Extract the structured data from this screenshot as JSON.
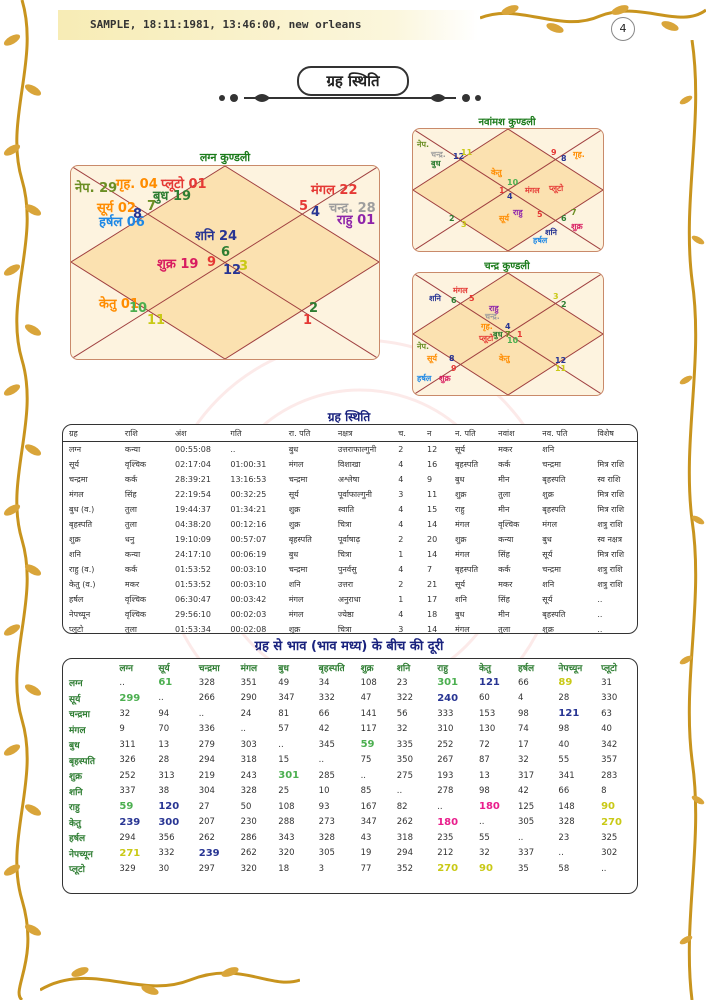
{
  "header": {
    "text": "SAMPLE, 18:11:1981, 13:46:00, new orleans",
    "page_number": "4"
  },
  "main_title": "ग्रह स्थिति",
  "lagna_kundli": {
    "title": "लग्न कुण्डली",
    "labels": [
      {
        "text": "नेप. 29",
        "color": "#6b8e23"
      },
      {
        "text": "गृह. 04",
        "color": "#ff8c00"
      },
      {
        "text": "प्लूटो 01",
        "color": "#e53935"
      },
      {
        "text": "बुध 19",
        "color": "#2e7d32"
      },
      {
        "text": "सूर्य 02",
        "color": "#ff8c00"
      },
      {
        "text": "हर्षल 06",
        "color": "#1e88e5"
      },
      {
        "text": "8",
        "color": "#283593"
      },
      {
        "text": "7",
        "color": "#6b8e23"
      },
      {
        "text": "मंगल 22",
        "color": "#e53935"
      },
      {
        "text": "5",
        "color": "#e53935"
      },
      {
        "text": "4",
        "color": "#283593"
      },
      {
        "text": "चन्द्र. 28",
        "color": "#9e9e9e"
      },
      {
        "text": "राहु 01",
        "color": "#8e24aa"
      },
      {
        "text": "शनि 24",
        "color": "#283593"
      },
      {
        "text": "6",
        "color": "#2e7d32"
      },
      {
        "text": "शुक्र 19",
        "color": "#d81b60"
      },
      {
        "text": "9",
        "color": "#e53935"
      },
      {
        "text": "12",
        "color": "#283593"
      },
      {
        "text": "3",
        "color": "#c9c916"
      },
      {
        "text": "केतु 01",
        "color": "#ff8c00"
      },
      {
        "text": "10",
        "color": "#4caf50"
      },
      {
        "text": "11",
        "color": "#c9c916"
      },
      {
        "text": "2",
        "color": "#2e7d32"
      },
      {
        "text": "1",
        "color": "#e53935"
      }
    ]
  },
  "navamsha_kundli": {
    "title": "नवांमश कुण्डली",
    "labels": [
      {
        "text": "नेप.",
        "color": "#6b8e23"
      },
      {
        "text": "चन्द्र.",
        "color": "#9e9e9e"
      },
      {
        "text": "बुध",
        "color": "#2e7d32"
      },
      {
        "text": "12",
        "color": "#283593"
      },
      {
        "text": "11",
        "color": "#c9c916"
      },
      {
        "text": "9",
        "color": "#e53935"
      },
      {
        "text": "8",
        "color": "#283593"
      },
      {
        "text": "गृह.",
        "color": "#ff8c00"
      },
      {
        "text": "केतु",
        "color": "#ff8c00"
      },
      {
        "text": "10",
        "color": "#4caf50"
      },
      {
        "text": "1",
        "color": "#e53935"
      },
      {
        "text": "4",
        "color": "#283593"
      },
      {
        "text": "मंगल",
        "color": "#e53935"
      },
      {
        "text": "प्लूटो",
        "color": "#e53935"
      },
      {
        "text": "2",
        "color": "#2e7d32"
      },
      {
        "text": "3",
        "color": "#c9c916"
      },
      {
        "text": "राहु",
        "color": "#8e24aa"
      },
      {
        "text": "सूर्य",
        "color": "#ff8c00"
      },
      {
        "text": "5",
        "color": "#e53935"
      },
      {
        "text": "6",
        "color": "#2e7d32"
      },
      {
        "text": "7",
        "color": "#6b8e23"
      },
      {
        "text": "शुक्र",
        "color": "#d81b60"
      },
      {
        "text": "शनि",
        "color": "#283593"
      },
      {
        "text": "हर्षल",
        "color": "#1e88e5"
      }
    ]
  },
  "chandra_kundli": {
    "title": "चन्द्र कुण्डली",
    "labels": [
      {
        "text": "मंगल",
        "color": "#e53935"
      },
      {
        "text": "शनि",
        "color": "#283593"
      },
      {
        "text": "6",
        "color": "#2e7d32"
      },
      {
        "text": "5",
        "color": "#e53935"
      },
      {
        "text": "3",
        "color": "#c9c916"
      },
      {
        "text": "2",
        "color": "#2e7d32"
      },
      {
        "text": "राहु",
        "color": "#8e24aa"
      },
      {
        "text": "चन्द्र.",
        "color": "#9e9e9e"
      },
      {
        "text": "4",
        "color": "#283593"
      },
      {
        "text": "गृह.",
        "color": "#ff8c00"
      },
      {
        "text": "बुध",
        "color": "#2e7d32"
      },
      {
        "text": "7",
        "color": "#6b8e23"
      },
      {
        "text": "प्लूटो",
        "color": "#e53935"
      },
      {
        "text": "1",
        "color": "#e53935"
      },
      {
        "text": "10",
        "color": "#4caf50"
      },
      {
        "text": "नेप.",
        "color": "#6b8e23"
      },
      {
        "text": "सूर्य",
        "color": "#ff8c00"
      },
      {
        "text": "8",
        "color": "#283593"
      },
      {
        "text": "9",
        "color": "#e53935"
      },
      {
        "text": "हर्षल",
        "color": "#1e88e5"
      },
      {
        "text": "शुक्र",
        "color": "#d81b60"
      },
      {
        "text": "केतु",
        "color": "#ff8c00"
      },
      {
        "text": "12",
        "color": "#283593"
      },
      {
        "text": "11",
        "color": "#c9c916"
      }
    ]
  },
  "graha_sthiti": {
    "title": "ग्रह स्थिति",
    "headers": [
      "ग्रह",
      "राशि",
      "अंश",
      "गति",
      "रा. पति",
      "नक्षत्र",
      "च.",
      "न",
      "न. पति",
      "नवांश",
      "नव. पति",
      "विशेष"
    ],
    "rows": [
      [
        "लग्न",
        "कन्या",
        "00:55:08",
        "..",
        "बुध",
        "उत्तराफाल्गुनी",
        "2",
        "12",
        "सूर्य",
        "मकर",
        "शनि",
        ""
      ],
      [
        "सूर्य",
        "वृश्चिक",
        "02:17:04",
        "01:00:31",
        "मंगल",
        "विशाखा",
        "4",
        "16",
        "बृहस्पति",
        "कर्क",
        "चन्द्रमा",
        "मित्र राशि"
      ],
      [
        "चन्द्रमा",
        "कर्क",
        "28:39:21",
        "13:16:53",
        "चन्द्रमा",
        "अश्लेषा",
        "4",
        "9",
        "बुध",
        "मीन",
        "बृहस्पति",
        "स्व राशि"
      ],
      [
        "मंगल",
        "सिंह",
        "22:19:54",
        "00:32:25",
        "सूर्य",
        "पूर्वाफाल्गुनी",
        "3",
        "11",
        "शुक्र",
        "तुला",
        "शुक्र",
        "मित्र राशि"
      ],
      [
        "बुध (व.)",
        "तुला",
        "19:44:37",
        "01:34:21",
        "शुक्र",
        "स्वाति",
        "4",
        "15",
        "राहु",
        "मीन",
        "बृहस्पति",
        "मित्र राशि"
      ],
      [
        "बृहस्पति",
        "तुला",
        "04:38:20",
        "00:12:16",
        "शुक्र",
        "चित्रा",
        "4",
        "14",
        "मंगल",
        "वृश्चिक",
        "मंगल",
        "शत्रु राशि"
      ],
      [
        "शुक्र",
        "धनु",
        "19:10:09",
        "00:57:07",
        "बृहस्पति",
        "पूर्वाषाढ़",
        "2",
        "20",
        "शुक्र",
        "कन्या",
        "बुध",
        "स्व नक्षत्र"
      ],
      [
        "शनि",
        "कन्या",
        "24:17:10",
        "00:06:19",
        "बुध",
        "चित्रा",
        "1",
        "14",
        "मंगल",
        "सिंह",
        "सूर्य",
        "मित्र राशि"
      ],
      [
        "राहु (व.)",
        "कर्क",
        "01:53:52",
        "00:03:10",
        "चन्द्रमा",
        "पुनर्वसु",
        "4",
        "7",
        "बृहस्पति",
        "कर्क",
        "चन्द्रमा",
        "शत्रु राशि"
      ],
      [
        "केतु (व.)",
        "मकर",
        "01:53:52",
        "00:03:10",
        "शनि",
        "उत्तरा",
        "2",
        "21",
        "सूर्य",
        "मकर",
        "शनि",
        "शत्रु राशि"
      ],
      [
        "हर्षल",
        "वृश्चिक",
        "06:30:47",
        "00:03:42",
        "मंगल",
        "अनुराधा",
        "1",
        "17",
        "शनि",
        "सिंह",
        "सूर्य",
        ".."
      ],
      [
        "नेपच्यून",
        "वृश्चिक",
        "29:56:10",
        "00:02:03",
        "मंगल",
        "ज्येष्ठा",
        "4",
        "18",
        "बुध",
        "मीन",
        "बृहस्पति",
        ".."
      ],
      [
        "प्लूटो",
        "तुला",
        "01:53:34",
        "00:02:08",
        "शुक्र",
        "चित्रा",
        "3",
        "14",
        "मंगल",
        "तुला",
        "शुक्र",
        ".."
      ]
    ]
  },
  "bhava_distance": {
    "title": "ग्रह से भाव (भाव मध्य) के बीच की दूरी",
    "headers": [
      "",
      "लग्न",
      "सूर्य",
      "चन्द्रमा",
      "मंगल",
      "बुध",
      "बृहस्पति",
      "शुक्र",
      "शनि",
      "राहु",
      "केतु",
      "हर्षल",
      "नेपच्यून",
      "प्लूटो"
    ],
    "rows": [
      [
        "लग्न",
        "..",
        "61",
        "328",
        "351",
        "49",
        "34",
        "108",
        "23",
        "301",
        "121",
        "66",
        "89",
        "31"
      ],
      [
        "सूर्य",
        "299",
        "..",
        "266",
        "290",
        "347",
        "332",
        "47",
        "322",
        "240",
        "60",
        "4",
        "28",
        "330"
      ],
      [
        "चन्द्रमा",
        "32",
        "94",
        "..",
        "24",
        "81",
        "66",
        "141",
        "56",
        "333",
        "153",
        "98",
        "121",
        "63"
      ],
      [
        "मंगल",
        "9",
        "70",
        "336",
        "..",
        "57",
        "42",
        "117",
        "32",
        "310",
        "130",
        "74",
        "98",
        "40"
      ],
      [
        "बुध",
        "311",
        "13",
        "279",
        "303",
        "..",
        "345",
        "59",
        "335",
        "252",
        "72",
        "17",
        "40",
        "342"
      ],
      [
        "बृहस्पति",
        "326",
        "28",
        "294",
        "318",
        "15",
        "..",
        "75",
        "350",
        "267",
        "87",
        "32",
        "55",
        "357"
      ],
      [
        "शुक्र",
        "252",
        "313",
        "219",
        "243",
        "301",
        "285",
        "..",
        "275",
        "193",
        "13",
        "317",
        "341",
        "283"
      ],
      [
        "शनि",
        "337",
        "38",
        "304",
        "328",
        "25",
        "10",
        "85",
        "..",
        "278",
        "98",
        "42",
        "66",
        "8"
      ],
      [
        "राहु",
        "59",
        "120",
        "27",
        "50",
        "108",
        "93",
        "167",
        "82",
        "..",
        "180",
        "125",
        "148",
        "90"
      ],
      [
        "केतु",
        "239",
        "300",
        "207",
        "230",
        "288",
        "273",
        "347",
        "262",
        "180",
        "..",
        "305",
        "328",
        "270"
      ],
      [
        "हर्षल",
        "294",
        "356",
        "262",
        "286",
        "343",
        "328",
        "43",
        "318",
        "235",
        "55",
        "..",
        "23",
        "325"
      ],
      [
        "नेपच्यून",
        "271",
        "332",
        "239",
        "262",
        "320",
        "305",
        "19",
        "294",
        "212",
        "32",
        "337",
        "..",
        "302"
      ],
      [
        "प्लूटो",
        "329",
        "30",
        "297",
        "320",
        "18",
        "3",
        "77",
        "352",
        "270",
        "90",
        "35",
        "58",
        ".."
      ]
    ],
    "highlights": [
      {
        "row": 0,
        "col": 2,
        "color": "green"
      },
      {
        "row": 0,
        "col": 9,
        "color": "green"
      },
      {
        "row": 0,
        "col": 10,
        "color": "blue"
      },
      {
        "row": 0,
        "col": 12,
        "color": "yellow"
      },
      {
        "row": 1,
        "col": 1,
        "color": "green"
      },
      {
        "row": 1,
        "col": 9,
        "color": "blue"
      },
      {
        "row": 2,
        "col": 12,
        "color": "blue"
      },
      {
        "row": 4,
        "col": 7,
        "color": "green"
      },
      {
        "row": 6,
        "col": 5,
        "color": "green"
      },
      {
        "row": 8,
        "col": 1,
        "color": "green"
      },
      {
        "row": 8,
        "col": 2,
        "color": "blue"
      },
      {
        "row": 8,
        "col": 10,
        "color": "magenta"
      },
      {
        "row": 8,
        "col": 13,
        "color": "yellow"
      },
      {
        "row": 9,
        "col": 1,
        "color": "blue"
      },
      {
        "row": 9,
        "col": 2,
        "color": "blue"
      },
      {
        "row": 9,
        "col": 9,
        "color": "magenta"
      },
      {
        "row": 9,
        "col": 13,
        "color": "yellow"
      },
      {
        "row": 11,
        "col": 1,
        "color": "yellow"
      },
      {
        "row": 11,
        "col": 3,
        "color": "blue"
      },
      {
        "row": 12,
        "col": 9,
        "color": "yellow"
      },
      {
        "row": 12,
        "col": 10,
        "color": "yellow"
      }
    ]
  }
}
